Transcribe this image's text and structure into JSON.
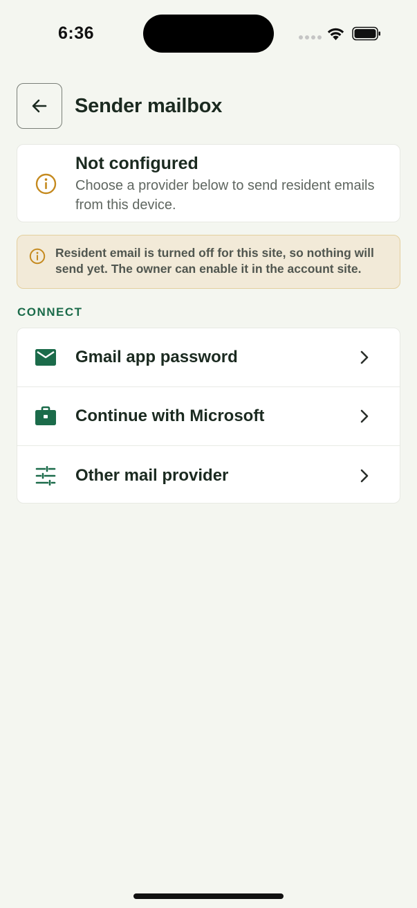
{
  "status_bar": {
    "time": "6:36"
  },
  "header": {
    "title": "Sender mailbox"
  },
  "status_card": {
    "title": "Not configured",
    "description": "Choose a provider below to send resident emails from this device.",
    "icon": "info-circle-icon"
  },
  "warning": {
    "text": "Resident email is turned off for this site, so nothing will send yet. The owner can enable it in the account site.",
    "icon": "info-circle-icon"
  },
  "connect": {
    "section_label": "CONNECT",
    "items": [
      {
        "label": "Gmail app password",
        "icon": "envelope-icon"
      },
      {
        "label": "Continue with Microsoft",
        "icon": "briefcase-icon"
      },
      {
        "label": "Other mail provider",
        "icon": "sliders-icon"
      }
    ]
  },
  "colors": {
    "background": "#f4f6f0",
    "accent_green": "#1b6b4a",
    "warning_bg": "#f2ead8",
    "warning_border": "#e3cf9e",
    "warning_icon": "#c58a1f",
    "text_dark": "#1b2a20"
  }
}
